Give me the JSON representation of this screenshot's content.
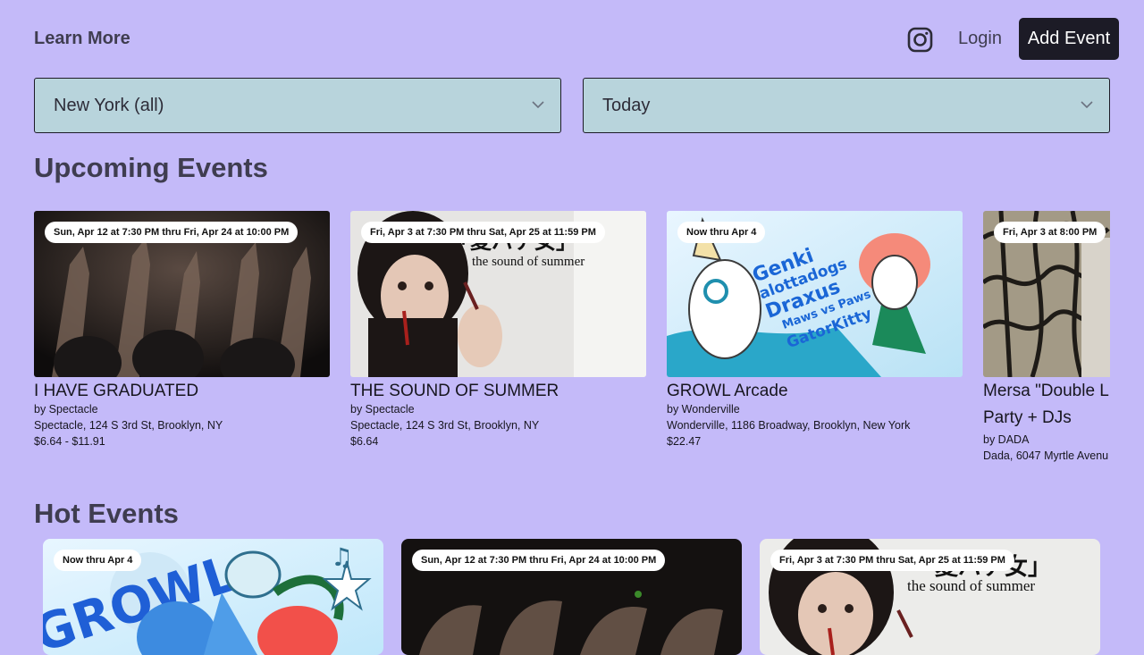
{
  "header": {
    "learn_more": "Learn More",
    "login": "Login",
    "add_event": "Add Event"
  },
  "filters": {
    "location": "New York (all)",
    "date": "Today"
  },
  "upcoming": {
    "title": "Upcoming Events",
    "events": [
      {
        "badge": "Sun, Apr 12 at 7:30 PM thru Fri, Apr 24 at 10:00 PM",
        "title": "I HAVE GRADUATED",
        "organizer": "by Spectacle",
        "venue": "Spectacle, 124 S 3rd St, Brooklyn, NY",
        "price": "$6.64 - $11.91"
      },
      {
        "badge": "Fri, Apr 3 at 7:30 PM thru Sat, Apr 25 at 11:59 PM",
        "title": "THE SOUND OF SUMMER",
        "organizer": "by Spectacle",
        "venue": "Spectacle, 124 S 3rd St, Brooklyn, NY",
        "price": "$6.64",
        "image_text": "the sound of summer",
        "image_text_jp": "「夏バテ女」"
      },
      {
        "badge": "Now thru Apr 4",
        "title": "GROWL Arcade",
        "organizer": "by Wonderville",
        "venue": "Wonderville, 1186 Broadway, Brooklyn, New York",
        "price": "$22.47",
        "image_lines": [
          "Genki",
          "alottadogs",
          "Draxus",
          "Maws vs Paws",
          "GatorKitty"
        ]
      },
      {
        "badge": "Fri, Apr 3 at 8:00 PM",
        "title": "Mersa \"Double L",
        "title_2": "Party + DJs",
        "organizer": "by DADA",
        "venue": "Dada, 6047 Myrtle Avenu"
      }
    ]
  },
  "hot": {
    "title": "Hot Events",
    "events": [
      {
        "badge": "Now thru Apr 4",
        "image_text": "GROWL"
      },
      {
        "badge": "Sun, Apr 12 at 7:30 PM thru Fri, Apr 24 at 10:00 PM"
      },
      {
        "badge": "Fri, Apr 3 at 7:30 PM thru Sat, Apr 25 at 11:59 PM",
        "image_text": "the sound of summer",
        "image_text_jp": "「夏バテ女」"
      }
    ]
  },
  "colors": {
    "background": "#c4baf9",
    "select_bg": "#b8d4dc",
    "button_dark": "#1c1b26"
  },
  "icons": [
    "instagram-icon",
    "chevron-down-icon"
  ]
}
